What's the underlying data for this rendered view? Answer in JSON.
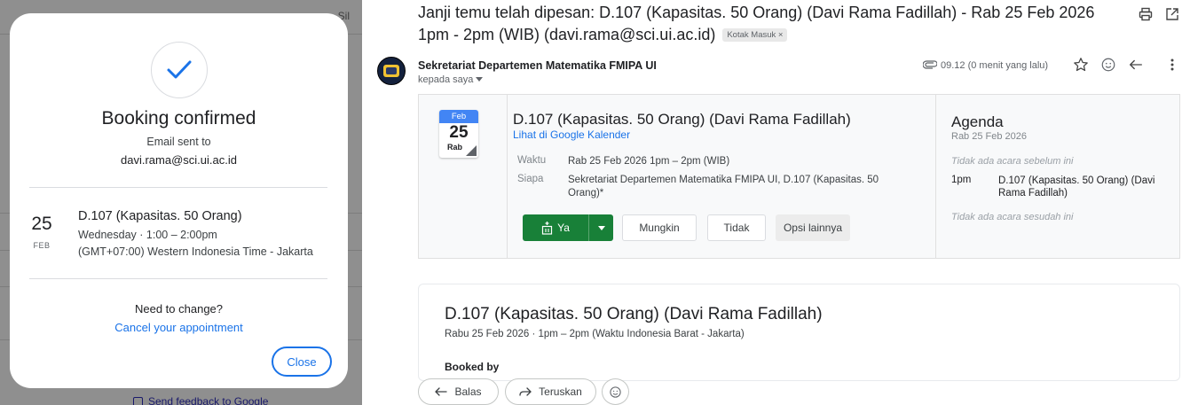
{
  "background_page": {
    "peek_text": "s, Sil",
    "feedback_link": "Send feedback to Google"
  },
  "booking_modal": {
    "title": "Booking confirmed",
    "email_sent_label": "Email sent to",
    "email": "davi.rama@sci.ui.ac.id",
    "date_day": "25",
    "date_month": "FEB",
    "event_title": "D.107 (Kapasitas. 50 Orang)",
    "event_time": "Wednesday · 1:00 – 2:00pm",
    "event_timezone": "(GMT+07:00) Western Indonesia Time - Jakarta",
    "need_change": "Need to change?",
    "cancel_link": "Cancel your appointment",
    "close_label": "Close",
    "accent_color": "#1a73e8"
  },
  "email": {
    "subject_line1": "Janji temu telah dipesan: D.107 (Kapasitas. 50 Orang) (Davi Rama Fadillah) - Rab 25 Feb 2026",
    "subject_line2": "1pm - 2pm (WIB) (davi.rama@sci.ui.ac.id)",
    "label_chip": "Kotak Masuk ×",
    "sender": "Sekretariat Departemen Matematika FMIPA UI",
    "recipient": "kepada saya",
    "timestamp": "09.12 (0 menit yang lalu)",
    "icons": [
      "print-icon",
      "open-in-new-icon",
      "paperclip-icon",
      "star-icon",
      "emoji-icon",
      "reply-icon",
      "more-vert-icon"
    ]
  },
  "invite": {
    "cal_month": "Feb",
    "cal_day": "25",
    "cal_dow": "Rab",
    "title": "D.107 (Kapasitas. 50 Orang) (Davi Rama Fadillah)",
    "calendar_link": "Lihat di Google Kalender",
    "when_label": "Waktu",
    "when_value": "Rab 25 Feb 2026 1pm – 2pm (WIB)",
    "who_label": "Siapa",
    "who_value": "Sekretariat Departemen Matematika FMIPA UI, D.107 (Kapasitas. 50 Orang)*",
    "yes_label": "Ya",
    "maybe_label": "Mungkin",
    "no_label": "Tidak",
    "more_options_label": "Opsi lainnya",
    "yes_color": "#188038"
  },
  "agenda": {
    "title": "Agenda",
    "date": "Rab 25 Feb 2026",
    "none_before": "Tidak ada acara sebelum ini",
    "event_time": "1pm",
    "event_title": "D.107 (Kapasitas. 50 Orang) (Davi Rama Fadillah)",
    "none_after": "Tidak ada acara sesudah ini"
  },
  "body": {
    "title": "D.107 (Kapasitas. 50 Orang) (Davi Rama Fadillah)",
    "subtitle": "Rabu 25 Feb 2026 · 1pm – 2pm (Waktu Indonesia Barat - Jakarta)",
    "booked_by_partial": "Booked by"
  },
  "actions": {
    "reply_label": "Balas",
    "forward_label": "Teruskan"
  }
}
